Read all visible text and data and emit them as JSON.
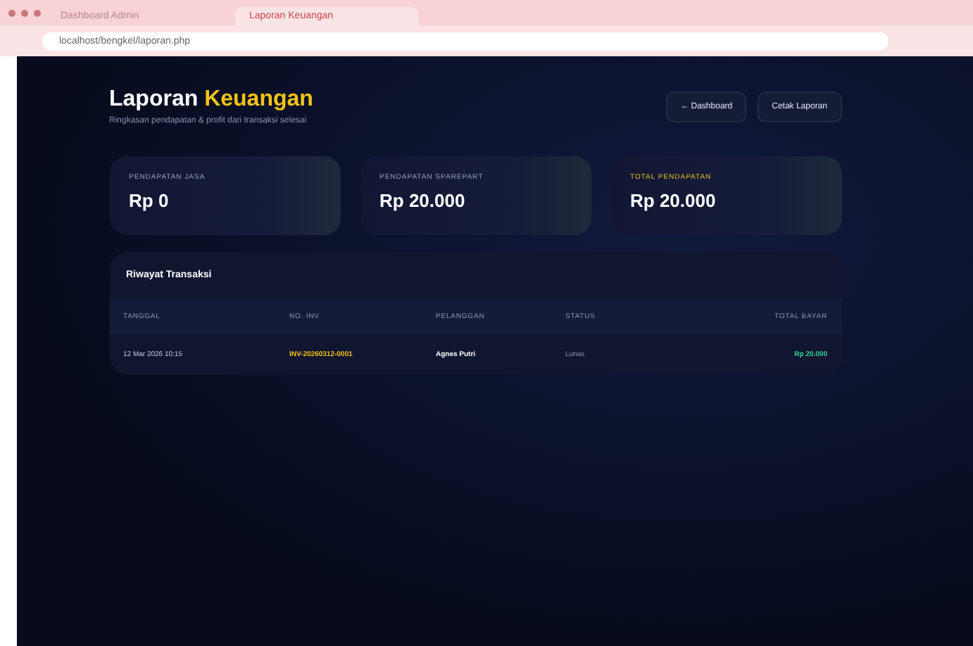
{
  "browser": {
    "tabs": [
      {
        "label": "Dashboard Admin",
        "selected": false
      },
      {
        "label": "Laporan Keuangan",
        "selected": true
      }
    ],
    "url": "localhost/bengkel/laporan.php"
  },
  "header": {
    "title": "Laporan",
    "title_accent": "Keuangan",
    "subtitle": "Ringkasan pendapatan & profit dari transaksi selesai"
  },
  "buttons": [
    {
      "label": "← Dashboard"
    },
    {
      "label": "Cetak Laporan"
    }
  ],
  "stats": [
    {
      "label": "PENDAPATAN JASA",
      "value": "Rp 0",
      "highlight": false
    },
    {
      "label": "PENDAPATAN SPAREPART",
      "value": "Rp 20.000",
      "highlight": false
    },
    {
      "label": "TOTAL PENDAPATAN",
      "value": "Rp 20.000",
      "highlight": true
    }
  ],
  "table": {
    "title": "Riwayat Transaksi",
    "columns": [
      "TANGGAL",
      "NO. INV",
      "PELANGGAN",
      "STATUS",
      "TOTAL BAYAR"
    ],
    "rows": [
      {
        "cells": [
          "12 Mar 2026 10:15",
          "INV-20260312-0001",
          "Agnes Putri",
          "Lunas",
          "Rp 20.000"
        ]
      }
    ]
  }
}
